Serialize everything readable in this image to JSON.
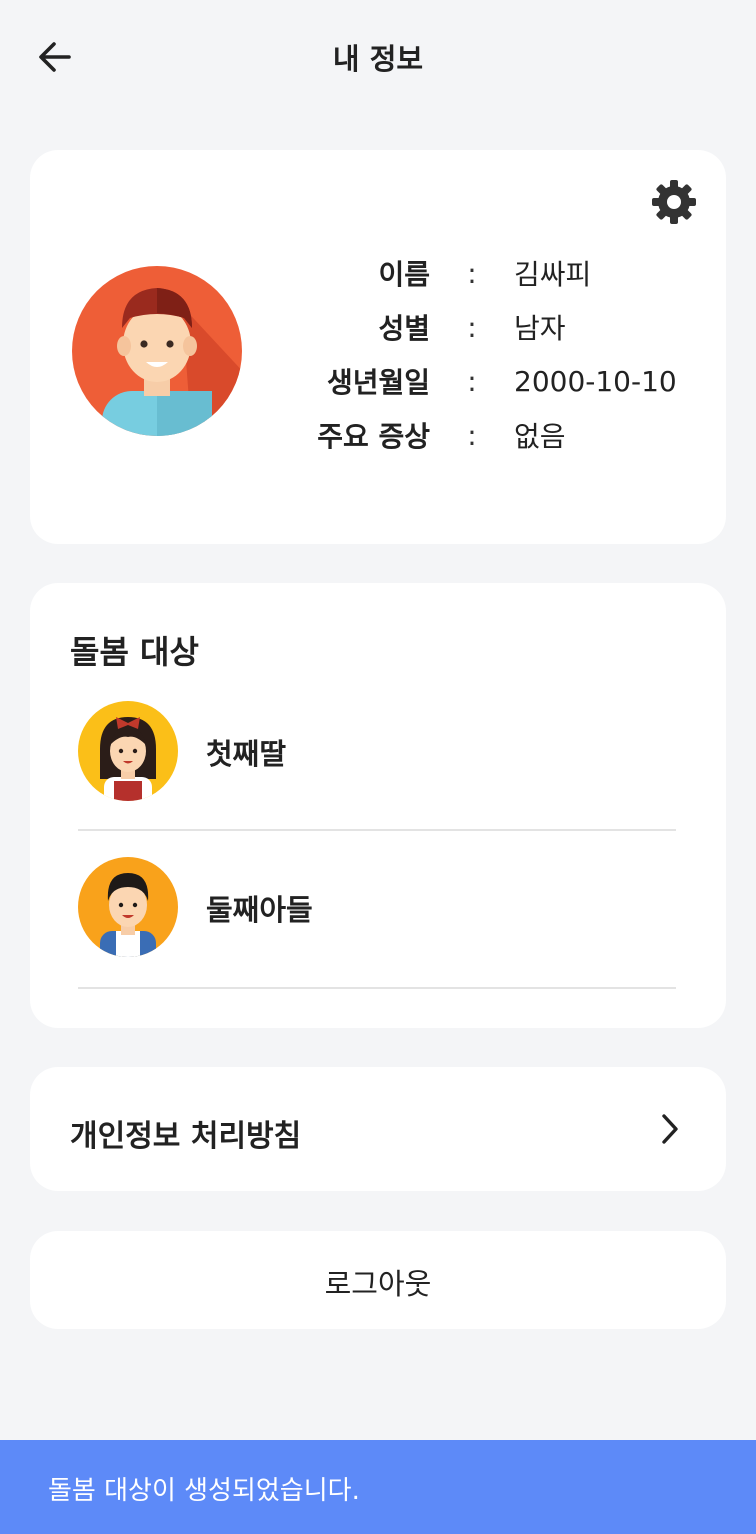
{
  "header": {
    "title": "내 정보",
    "back_icon": "arrow-left-icon"
  },
  "profile": {
    "settings_icon": "gear-icon",
    "avatar": "male-avatar",
    "fields": [
      {
        "label": "이름",
        "value": "김싸피"
      },
      {
        "label": "성별",
        "value": "남자"
      },
      {
        "label": "생년월일",
        "value": "2000-10-10"
      },
      {
        "label": "주요 증상",
        "value": "없음"
      }
    ],
    "colon": ":"
  },
  "care": {
    "title": "돌봄 대상",
    "items": [
      {
        "name": "첫째딸",
        "avatar": "girl-avatar"
      },
      {
        "name": "둘째아들",
        "avatar": "boy-avatar"
      }
    ]
  },
  "privacy": {
    "label": "개인정보 처리방침",
    "icon": "chevron-right-icon"
  },
  "logout": {
    "label": "로그아웃"
  },
  "toast": {
    "message": "돌봄 대상이 생성되었습니다."
  },
  "colors": {
    "background": "#f4f5f7",
    "card": "#ffffff",
    "toast": "#5d8af8",
    "divider": "#e3e3e3"
  }
}
